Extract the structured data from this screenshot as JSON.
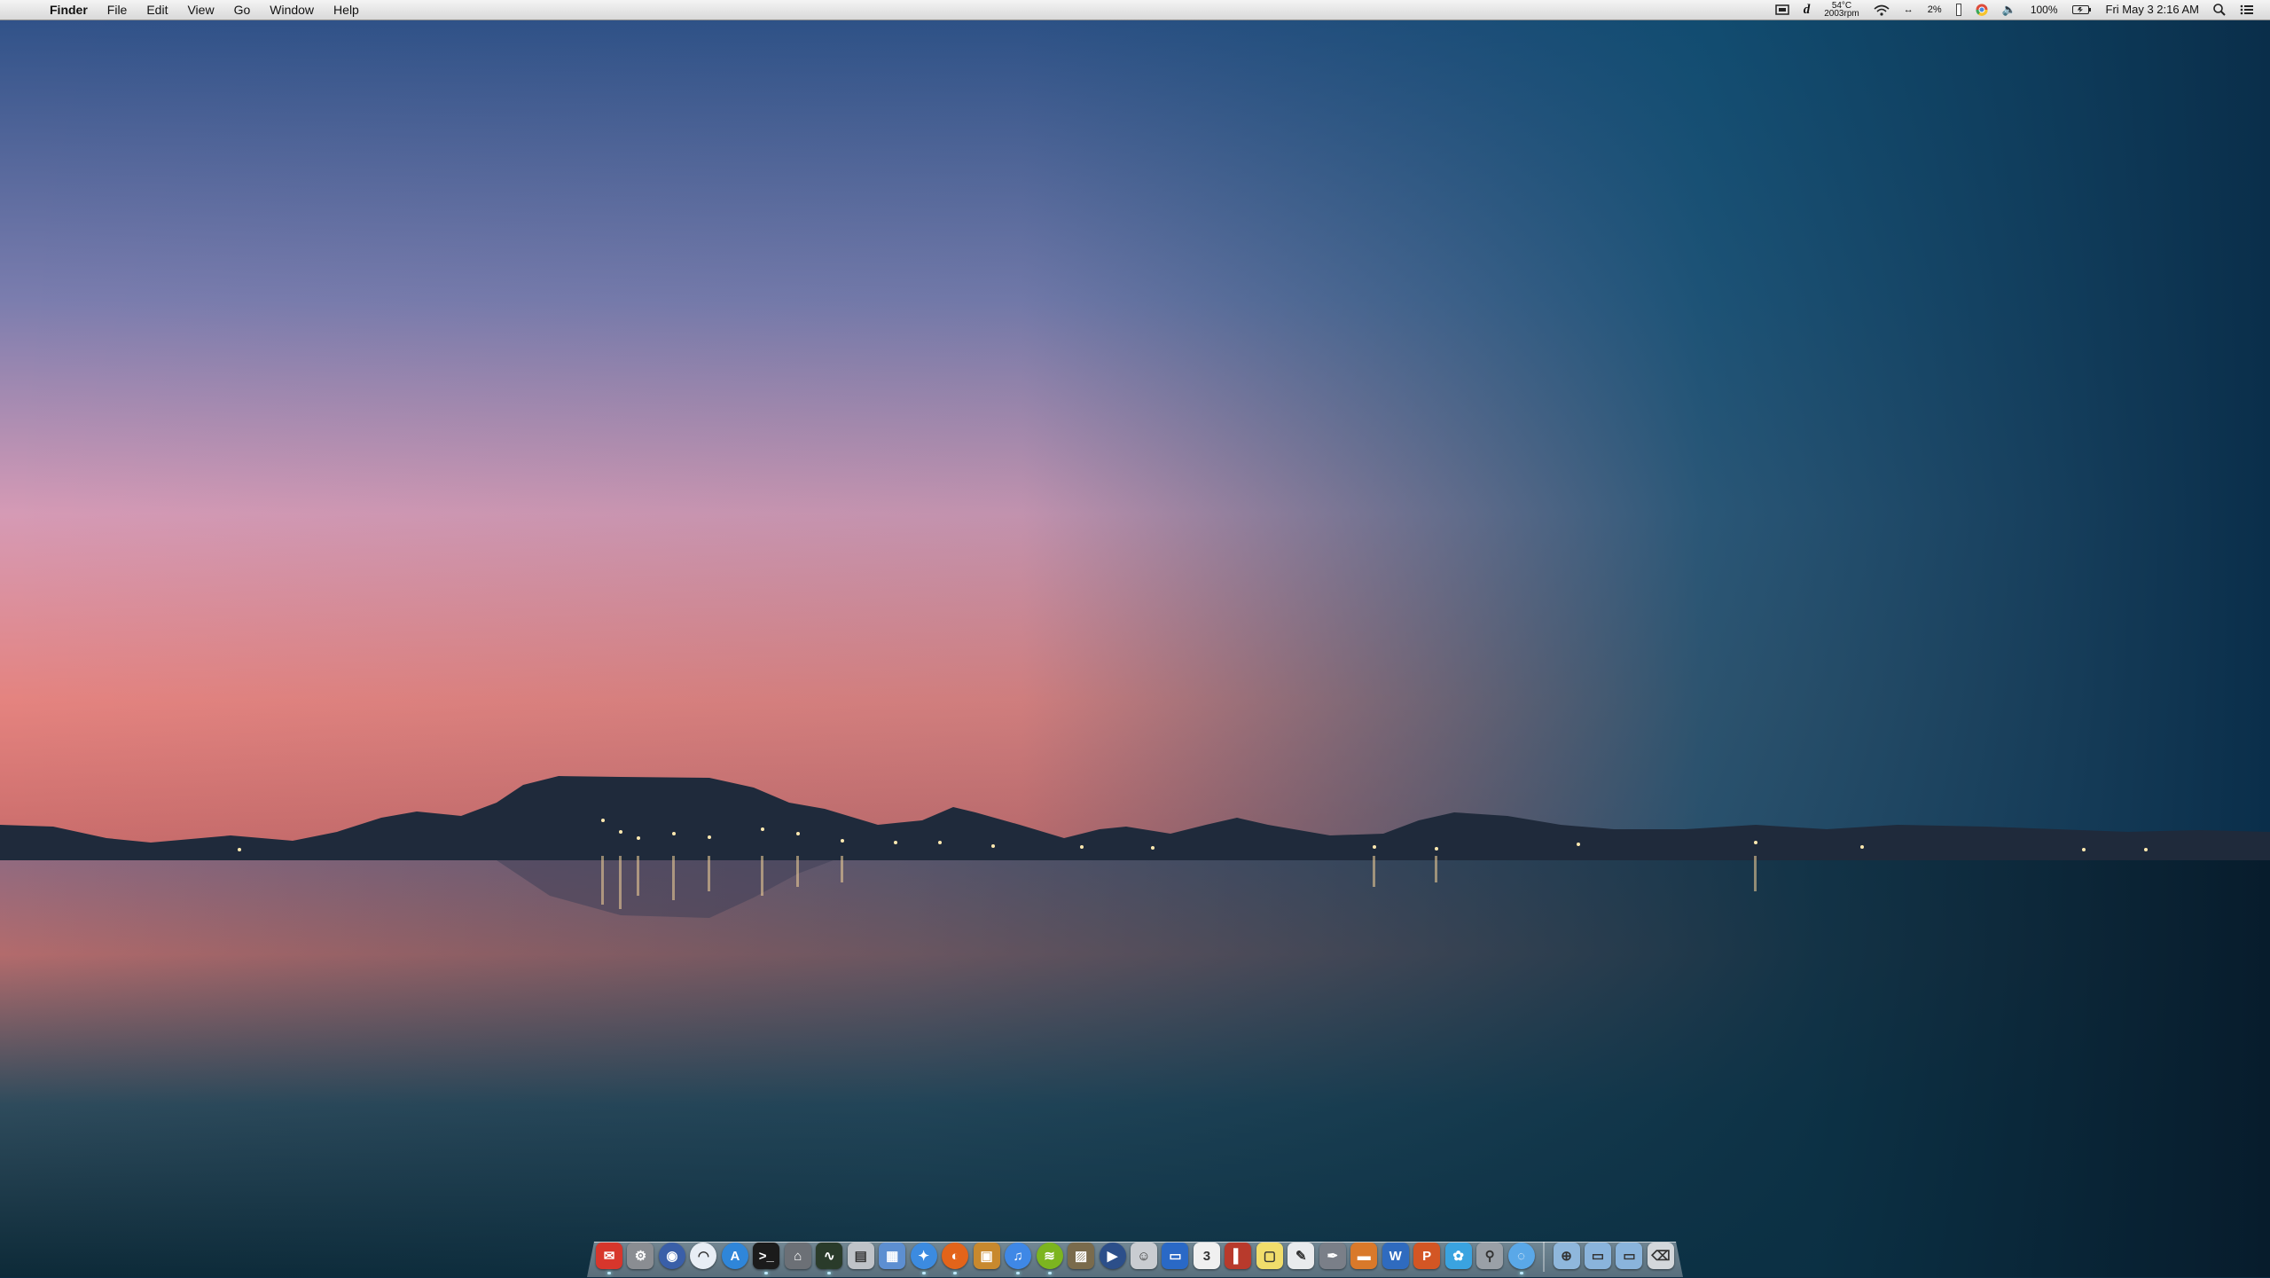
{
  "menubar": {
    "apple": "",
    "app_name": "Finder",
    "menus": [
      "File",
      "Edit",
      "View",
      "Go",
      "Window",
      "Help"
    ],
    "status": {
      "weather_temp": "54°C",
      "weather_sub": "2003rpm",
      "cpu": "2%",
      "battery": "100%",
      "datetime": "Fri May 3  2:16 AM"
    }
  },
  "dock": {
    "items": [
      {
        "name": "finder-icon",
        "color": "#d7362c",
        "glyph": "✉"
      },
      {
        "name": "system-preferences-icon",
        "color": "#8a8d92",
        "glyph": "⚙"
      },
      {
        "name": "dashboard-icon",
        "color": "#3a5fa8",
        "glyph": "◉"
      },
      {
        "name": "wifi-utility-icon",
        "color": "#e8eef5",
        "glyph": "◠"
      },
      {
        "name": "app-store-icon",
        "color": "#2f86d9",
        "glyph": "A"
      },
      {
        "name": "terminal-icon",
        "color": "#1b1b1b",
        "glyph": ">_"
      },
      {
        "name": "keychain-icon",
        "color": "#6c7076",
        "glyph": "⌂"
      },
      {
        "name": "activity-monitor-icon",
        "color": "#2a3b2a",
        "glyph": "∿"
      },
      {
        "name": "printer-icon",
        "color": "#bfc3c8",
        "glyph": "▤"
      },
      {
        "name": "preview-icon",
        "color": "#5d8fd1",
        "glyph": "▦"
      },
      {
        "name": "safari-icon",
        "color": "#3c8be0",
        "glyph": "✦"
      },
      {
        "name": "firefox-icon",
        "color": "#e3641a",
        "glyph": "◐"
      },
      {
        "name": "package-icon",
        "color": "#c8892e",
        "glyph": "▣"
      },
      {
        "name": "itunes-icon",
        "color": "#3f88e6",
        "glyph": "♫"
      },
      {
        "name": "spotify-icon",
        "color": "#7cb51f",
        "glyph": "≋"
      },
      {
        "name": "iphoto-icon",
        "color": "#7a6b4c",
        "glyph": "▨"
      },
      {
        "name": "quicktime-icon",
        "color": "#2c4f8a",
        "glyph": "▶"
      },
      {
        "name": "automator-icon",
        "color": "#c9ccd1",
        "glyph": "☺"
      },
      {
        "name": "remote-desktop-icon",
        "color": "#2a69c6",
        "glyph": "▭"
      },
      {
        "name": "calendar-icon",
        "color": "#f0f0f0",
        "glyph": "3"
      },
      {
        "name": "address-book-icon",
        "color": "#b83a2c",
        "glyph": "▌"
      },
      {
        "name": "stickies-icon",
        "color": "#f1dd6b",
        "glyph": "▢"
      },
      {
        "name": "textedit-icon",
        "color": "#e9ebed",
        "glyph": "✎"
      },
      {
        "name": "script-editor-icon",
        "color": "#7a7f88",
        "glyph": "✒"
      },
      {
        "name": "keynote-icon",
        "color": "#d9792a",
        "glyph": "▬"
      },
      {
        "name": "word-icon",
        "color": "#2f6bbf",
        "glyph": "W"
      },
      {
        "name": "powerpoint-icon",
        "color": "#d35624",
        "glyph": "P"
      },
      {
        "name": "twitter-icon",
        "color": "#3aa3e0",
        "glyph": "✿"
      },
      {
        "name": "utility-icon",
        "color": "#9aa0a7",
        "glyph": "⚲"
      },
      {
        "name": "messages-icon",
        "color": "#5aa8e8",
        "glyph": "◌"
      },
      {
        "name": "applications-folder-icon",
        "color": "#8fb7dc",
        "glyph": "⊕"
      },
      {
        "name": "documents-folder-icon",
        "color": "#8ab4dc",
        "glyph": "▭"
      },
      {
        "name": "downloads-folder-icon",
        "color": "#8ab4dc",
        "glyph": "▭"
      },
      {
        "name": "trash-icon",
        "color": "#d3d7db",
        "glyph": "⌫"
      }
    ]
  }
}
